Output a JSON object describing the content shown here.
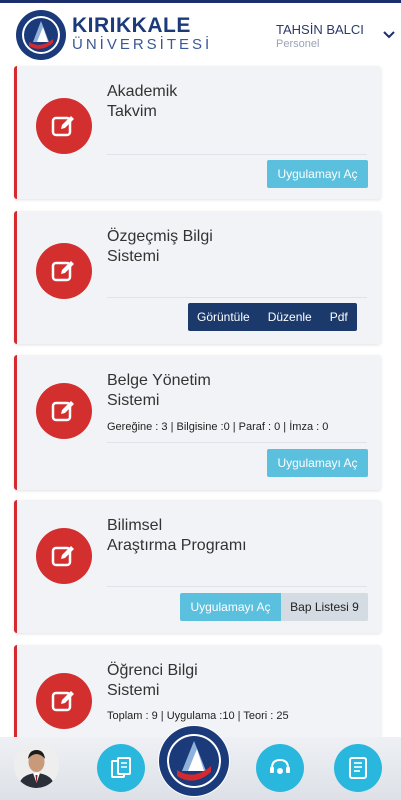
{
  "header": {
    "brand_top": "KIRIKKALE",
    "brand_bottom": "ÜNİVERSİTESİ",
    "logo_label": "KIRIKKALE ÜNİVERSİTESİ",
    "user_name": "TAHSİN BALCI",
    "user_role": "Personel",
    "menu_icon": "chevron-down-icon"
  },
  "cards": [
    {
      "title_line1": "Akademik",
      "title_line2": "Takvim",
      "open_label": "Uygulamayı Aç",
      "icon": "edit-icon"
    },
    {
      "title_line1": "Özgeçmiş Bilgi",
      "title_line2": "Sistemi",
      "buttons": [
        "Görüntüle",
        "Düzenle",
        "Pdf"
      ],
      "icon": "edit-icon"
    },
    {
      "title_line1": "Belge Yönetim",
      "title_line2": "Sistemi",
      "info": "Gereğine : 3 | Bilgisine :0 | Paraf : 0 | İmza : 0",
      "open_label": "Uygulamayı Aç",
      "icon": "edit-icon"
    },
    {
      "title_line1": "Bilimsel",
      "title_line2": "Araştırma Programı",
      "open_label": "Uygulamayı Aç",
      "secondary_label": "Bap Listesi 9",
      "icon": "edit-icon"
    },
    {
      "title_line1": "Öğrenci Bilgi",
      "title_line2": "Sistemi",
      "info": "Toplam : 9 | Uygulama :10 | Teori : 25",
      "icon": "edit-icon"
    }
  ],
  "footer": {
    "items": [
      "avatar",
      "documents-icon",
      "university-logo",
      "support-icon",
      "news-icon"
    ]
  },
  "colors": {
    "accent_red": "#d32f2f",
    "button_blue": "#5bc0de",
    "navy": "#1b3a6b",
    "footer_blue": "#2ab7de"
  }
}
